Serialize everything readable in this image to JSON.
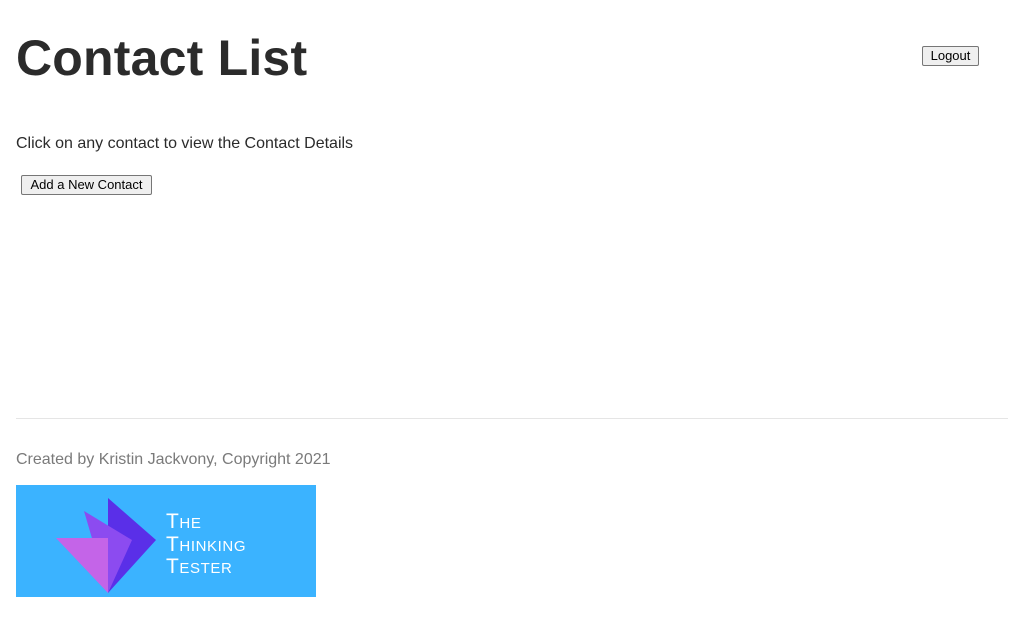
{
  "header": {
    "title": "Contact List",
    "logout_label": "Logout"
  },
  "main": {
    "instructions": "Click on any contact to view the Contact Details",
    "add_contact_label": "Add a New Contact"
  },
  "footer": {
    "credit": "Created by Kristin Jackvony, Copyright 2021",
    "logo": {
      "line1": "The",
      "line2": "Thinking",
      "line3": "Tester",
      "background_color": "#3bb3ff",
      "icon": "origami-bird-icon"
    }
  }
}
